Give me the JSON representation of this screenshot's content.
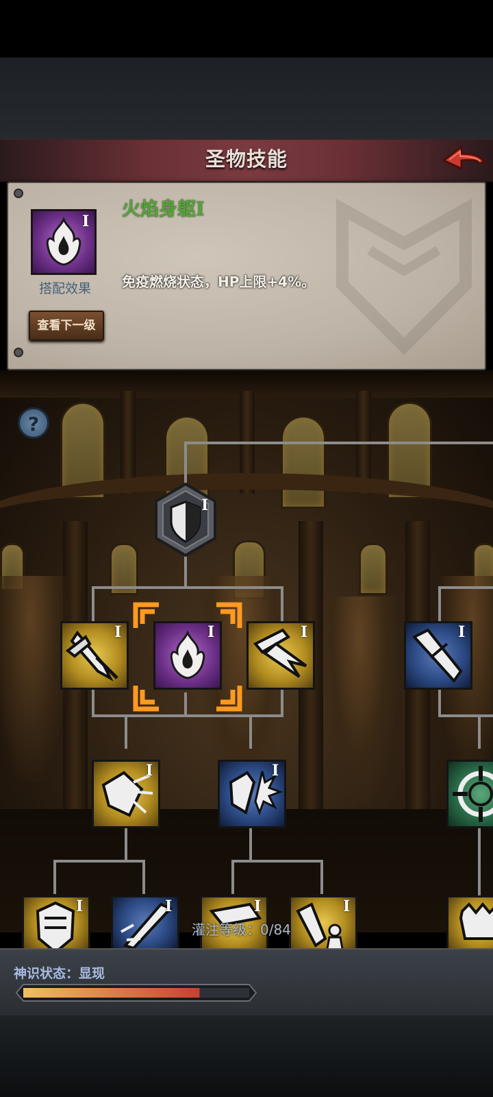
{
  "header": {
    "title": "圣物技能"
  },
  "skill_detail": {
    "name": "火焰身躯",
    "tier": "I",
    "combo_label": "搭配效果",
    "description": "免疫燃烧状态，HP上限+4%。",
    "next_level_button": "查看下一级"
  },
  "help": {
    "label": "?"
  },
  "tree": {
    "root": {
      "icon": "shield-icon",
      "tier": "I"
    },
    "row1": [
      {
        "icon": "axe-slash-icon",
        "color": "gold",
        "tier": "I"
      },
      {
        "icon": "flame-body-icon",
        "color": "purple",
        "tier": "I",
        "selected": true
      },
      {
        "icon": "sword-strike-icon",
        "color": "gold",
        "tier": "I"
      },
      {
        "icon": "blade-icon",
        "color": "blue",
        "tier": "I"
      }
    ],
    "row2": [
      {
        "icon": "shield-shatter-icon",
        "color": "gold",
        "tier": "I"
      },
      {
        "icon": "shield-burst-icon",
        "color": "blue",
        "tier": "I"
      },
      {
        "icon": "target-icon",
        "color": "green",
        "tier": ""
      }
    ],
    "row3": [
      {
        "icon": "armor-icon",
        "color": "gold",
        "tier": "I"
      },
      {
        "icon": "dagger-icon",
        "color": "blue",
        "tier": "I"
      },
      {
        "icon": "gauntlet-icon",
        "color": "gold",
        "tier": "I"
      },
      {
        "icon": "warrior-icon",
        "color": "gold",
        "tier": "I"
      },
      {
        "icon": "beast-icon",
        "color": "gold",
        "tier": ""
      }
    ]
  },
  "infusion": {
    "label": "灌注等级：0/84",
    "current": 0,
    "max": 84
  },
  "divine_sense": {
    "label": "神识状态：",
    "value": "显现",
    "progress": 0.78
  },
  "colors": {
    "skill_name": "#55a33a",
    "selection_frame": "#ff9a1e",
    "progress_fill_start": "#f0c060",
    "progress_fill_end": "#c84030"
  }
}
